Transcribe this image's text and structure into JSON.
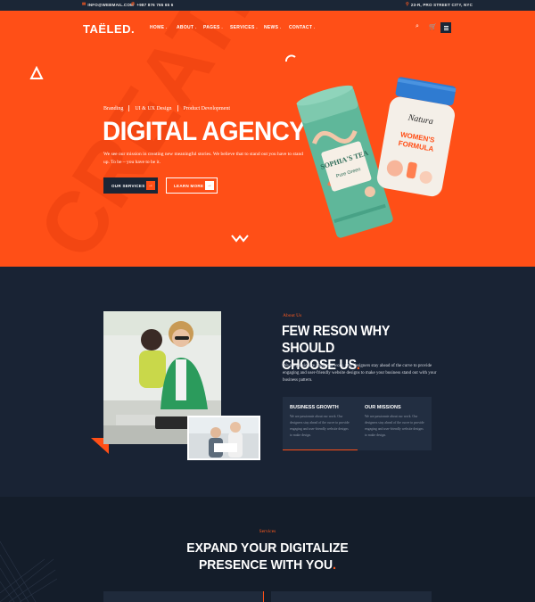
{
  "topbar": {
    "email": "INFO@WEBMAIL.COM",
    "phone": "+987 876 765 65 6",
    "address": "23-R, PRO STREET CITY, NYC"
  },
  "nav": {
    "logo": "TAËLED.",
    "menu": [
      "HOME",
      "ABOUT",
      "PAGES",
      "SERVICES",
      "NEWS",
      "CONTACT"
    ]
  },
  "hero": {
    "tags": [
      "Branding",
      "UI & UX Design",
      "Product Development"
    ],
    "title": "DIGITAL AGENCY",
    "description": "We see our mission in creating new meaningful stories. We believe that to stand out you have to stand up. To be – you have to be it.",
    "btn_primary": "OUR SERVICES",
    "btn_secondary": "LEARN MORE",
    "watermark": "CREATIVE",
    "product_left": {
      "brand": "SOPHIA'S TEA",
      "flavor": "Pure Green"
    },
    "product_right": {
      "brand": "Natura",
      "line1": "WOMEN'S",
      "line2": "FORMULA"
    }
  },
  "about": {
    "kicker": "About Us",
    "title_line1": "FEW RESON WHY SHOULD",
    "title_line2": "CHOOSE US",
    "description": "We are passionate about our work. Our designers stay ahead of the curve to provide engaging and user-friendly website designs to make your business stand out with your business pattern.",
    "cards": [
      {
        "title": "BUSINESS GROWTH",
        "text": "We are passionate about our work. Our designers stay ahead of the curve to provide engaging and user-friendly website designs to make design."
      },
      {
        "title": "OUR MISSIONS",
        "text": "We are passionate about our work. Our designers stay ahead of the curve to provide engaging and user-friendly website designs to make design."
      }
    ]
  },
  "services": {
    "kicker": "Services",
    "title_line1": "EXPAND YOUR DIGITALIZE",
    "title_line2": "PRESENCE WITH YOU"
  },
  "colors": {
    "accent": "#ff4f17",
    "dark": "#192334",
    "darker": "#141d2a"
  }
}
